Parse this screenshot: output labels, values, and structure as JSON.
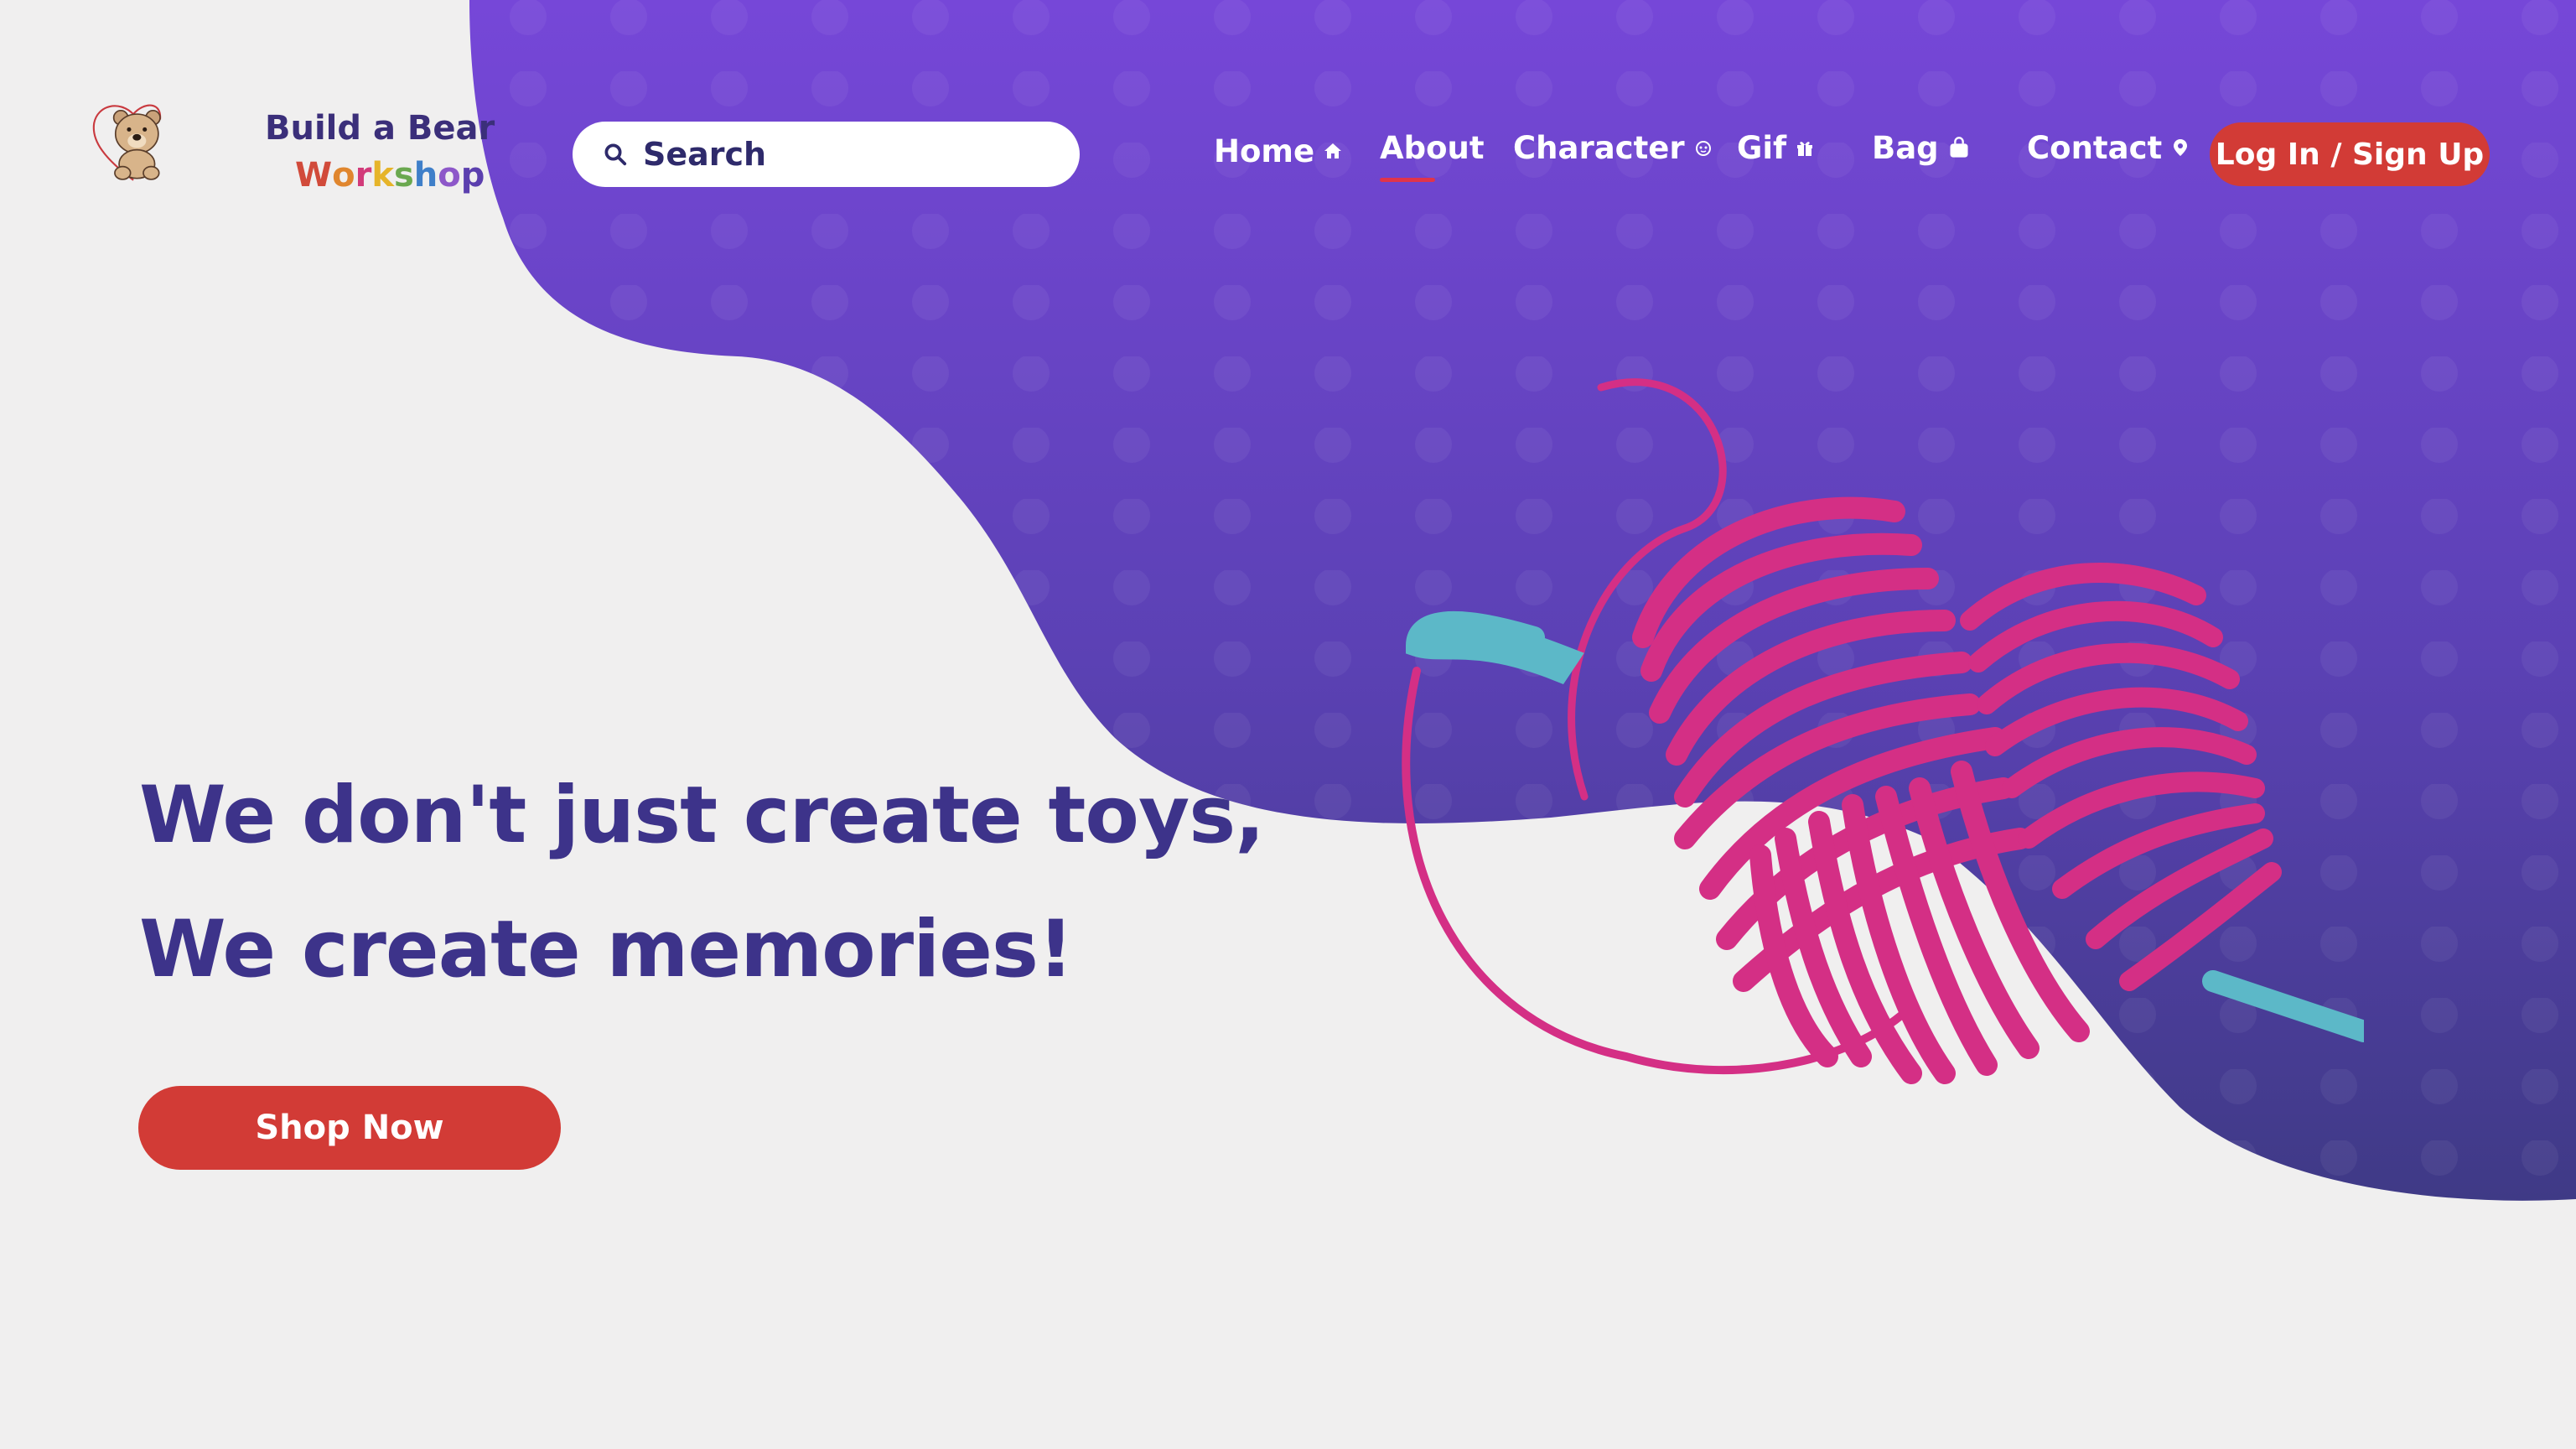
{
  "logo": {
    "line1": "Build a Bear",
    "line2_letters": [
      "W",
      "o",
      "r",
      "k",
      "s",
      "h",
      "o",
      "p"
    ],
    "line2_colors": [
      "#d14a3a",
      "#e0862e",
      "#d23b7a",
      "#e6b42a",
      "#6aa84f",
      "#3f7fc9",
      "#8d57c9",
      "#5b3fae"
    ],
    "icon": "teddy-bear-heart-logo"
  },
  "search": {
    "placeholder": "Search",
    "value": "",
    "icon": "search-icon"
  },
  "nav": {
    "items": [
      {
        "label": "Home",
        "icon": "home-icon"
      },
      {
        "label": "About",
        "icon": ""
      },
      {
        "label": "Character",
        "icon": "character-icon"
      },
      {
        "label": "Gif",
        "icon": "gift-icon"
      },
      {
        "label": "Bag",
        "icon": "bag-icon"
      },
      {
        "label": "Contact",
        "icon": "location-pin-icon"
      }
    ],
    "active": "About",
    "login_label": "Log In / Sign Up"
  },
  "hero": {
    "line1": "We don't just create toys,",
    "line2": "We create memories!",
    "cta_label": "Shop Now"
  },
  "colors": {
    "purple_top": "#7647d8",
    "purple_bottom": "#3f3a86",
    "accent_red": "#d23b36",
    "headline": "#3d338a",
    "yarn_pink": "#d42f85",
    "needle_teal": "#5cb8c8",
    "background": "#f0efef"
  }
}
